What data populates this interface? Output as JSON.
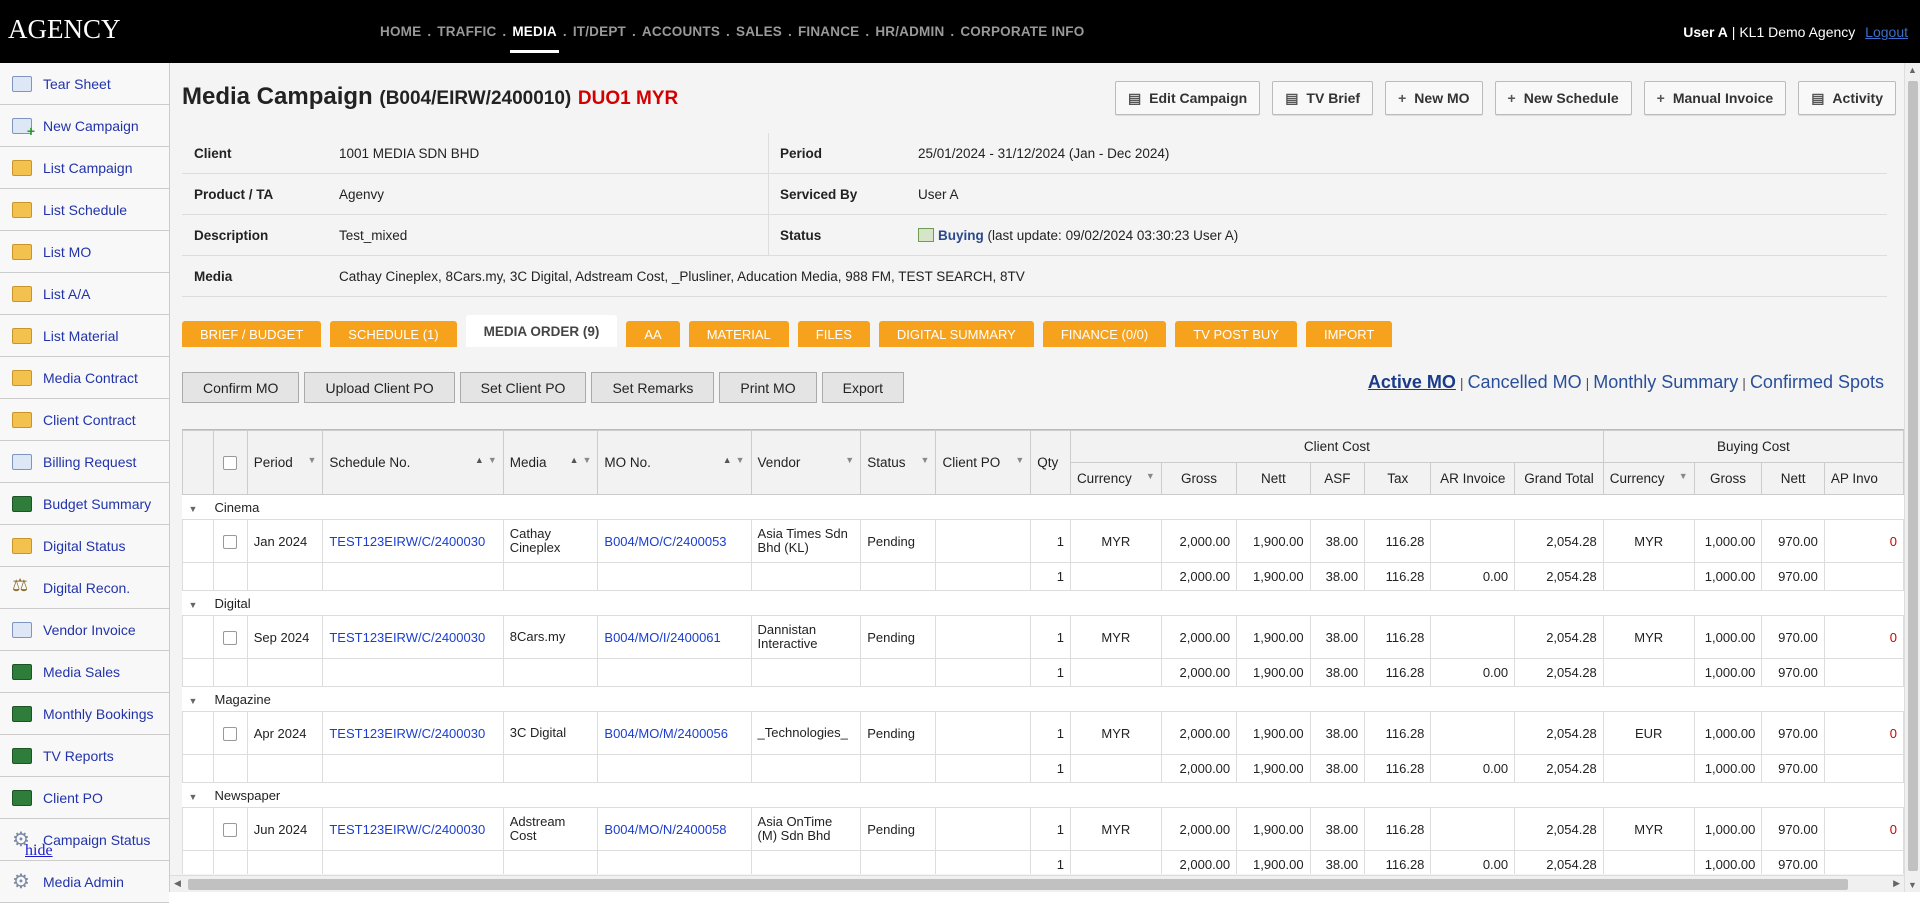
{
  "app": {
    "logo": "AGENCY"
  },
  "nav": {
    "items": [
      "HOME",
      "TRAFFIC",
      "MEDIA",
      "IT/DEPT",
      "ACCOUNTS",
      "SALES",
      "FINANCE",
      "HR/ADMIN",
      "CORPORATE INFO"
    ],
    "active": "MEDIA"
  },
  "user": {
    "name": "User A",
    "agency": "| KL1 Demo Agency",
    "logout": "Logout"
  },
  "sidebar": {
    "items": [
      {
        "label": "Tear Sheet",
        "icon": "page-icon"
      },
      {
        "label": "New Campaign",
        "icon": "new-page-icon"
      },
      {
        "label": "List Campaign",
        "icon": "folder-icon"
      },
      {
        "label": "List Schedule",
        "icon": "folder-icon"
      },
      {
        "label": "List MO",
        "icon": "folder-icon"
      },
      {
        "label": "List A/A",
        "icon": "folder-icon"
      },
      {
        "label": "List Material",
        "icon": "folder-icon"
      },
      {
        "label": "Media Contract",
        "icon": "folder-icon"
      },
      {
        "label": "Client Contract",
        "icon": "folder-icon"
      },
      {
        "label": "Billing Request",
        "icon": "page-icon"
      },
      {
        "label": "Budget Summary",
        "icon": "chart-icon"
      },
      {
        "label": "Digital Status",
        "icon": "folder-icon"
      },
      {
        "label": "Digital Recon.",
        "icon": "scale-icon"
      },
      {
        "label": "Vendor Invoice",
        "icon": "page-icon"
      },
      {
        "label": "Media Sales",
        "icon": "chart-icon"
      },
      {
        "label": "Monthly Bookings",
        "icon": "chart-icon"
      },
      {
        "label": "TV Reports",
        "icon": "chart-icon"
      },
      {
        "label": "Client PO",
        "icon": "chart-icon"
      },
      {
        "label": "Campaign Status",
        "icon": "gear-icon"
      },
      {
        "label": "Media Admin",
        "icon": "gear-icon"
      }
    ],
    "hide": "hide"
  },
  "page": {
    "title": "Media Campaign",
    "code": "(B004/EIRW/2400010)",
    "tag": "DUO1 MYR",
    "actions": [
      {
        "label": "Edit Campaign",
        "icon": "document-icon"
      },
      {
        "label": "TV Brief",
        "icon": "document-icon"
      },
      {
        "label": "New MO",
        "icon": "plus-icon"
      },
      {
        "label": "New Schedule",
        "icon": "plus-icon"
      },
      {
        "label": "Manual Invoice",
        "icon": "plus-icon"
      },
      {
        "label": "Activity",
        "icon": "document-icon"
      }
    ]
  },
  "info": {
    "client_label": "Client",
    "client": "1001 MEDIA SDN BHD",
    "period_label": "Period",
    "period": "25/01/2024 - 31/12/2024 (Jan - Dec 2024)",
    "product_label": "Product / TA",
    "product": "Agenvy",
    "serviced_label": "Serviced By",
    "serviced": "User A",
    "desc_label": "Description",
    "desc": "Test_mixed",
    "status_label": "Status",
    "status": "Buying",
    "status_note": "(last update: 09/02/2024 03:30:23 User A)",
    "media_label": "Media",
    "media": "Cathay Cineplex, 8Cars.my, 3C Digital, Adstream Cost, _Plusliner, Aducation Media, 988 FM, TEST SEARCH, 8TV"
  },
  "tabs": [
    "BRIEF / BUDGET",
    "SCHEDULE (1)",
    "MEDIA ORDER (9)",
    "AA",
    "MATERIAL",
    "FILES",
    "DIGITAL SUMMARY",
    "FINANCE (0/0)",
    "TV POST BUY",
    "IMPORT"
  ],
  "toolbar": [
    "Confirm MO",
    "Upload Client PO",
    "Set Client PO",
    "Set Remarks",
    "Print MO",
    "Export"
  ],
  "views": [
    "Active MO",
    "Cancelled MO",
    "Monthly Summary",
    "Confirmed Spots"
  ],
  "grid": {
    "group_headers": {
      "client_cost": "Client Cost",
      "buying_cost": "Buying Cost"
    },
    "columns": {
      "period": "Period",
      "schedule": "Schedule No.",
      "media": "Media",
      "mo": "MO No.",
      "vendor": "Vendor",
      "status": "Status",
      "client_po": "Client PO",
      "qty": "Qty",
      "currency": "Currency",
      "gross": "Gross",
      "nett": "Nett",
      "asf": "ASF",
      "tax": "Tax",
      "ar_invoice": "AR Invoice",
      "grand_total": "Grand Total",
      "b_currency": "Currency",
      "b_gross": "Gross",
      "b_nett": "Nett",
      "ap_invoice": "AP Invo"
    },
    "groups": [
      {
        "name": "Cinema",
        "row": {
          "period": "Jan 2024",
          "schedule": "TEST123EIRW/C/2400030",
          "media": "Cathay Cineplex",
          "mo": "B004/MO/C/2400053",
          "vendor": "Asia Times Sdn Bhd (KL)",
          "status": "Pending",
          "client_po": "",
          "qty": "1",
          "currency": "MYR",
          "gross": "2,000.00",
          "nett": "1,900.00",
          "asf": "38.00",
          "tax": "116.28",
          "ar_invoice": "",
          "grand_total": "2,054.28",
          "b_currency": "MYR",
          "b_gross": "1,000.00",
          "b_nett": "970.00",
          "ap": "0"
        },
        "sum": {
          "qty": "1",
          "gross": "2,000.00",
          "nett": "1,900.00",
          "asf": "38.00",
          "tax": "116.28",
          "ar_invoice": "0.00",
          "grand_total": "2,054.28",
          "b_gross": "1,000.00",
          "b_nett": "970.00"
        }
      },
      {
        "name": "Digital",
        "row": {
          "period": "Sep 2024",
          "schedule": "TEST123EIRW/C/2400030",
          "media": "8Cars.my",
          "mo": "B004/MO/I/2400061",
          "vendor": "Dannistan Interactive",
          "status": "Pending",
          "client_po": "",
          "qty": "1",
          "currency": "MYR",
          "gross": "2,000.00",
          "nett": "1,900.00",
          "asf": "38.00",
          "tax": "116.28",
          "ar_invoice": "",
          "grand_total": "2,054.28",
          "b_currency": "MYR",
          "b_gross": "1,000.00",
          "b_nett": "970.00",
          "ap": "0"
        },
        "sum": {
          "qty": "1",
          "gross": "2,000.00",
          "nett": "1,900.00",
          "asf": "38.00",
          "tax": "116.28",
          "ar_invoice": "0.00",
          "grand_total": "2,054.28",
          "b_gross": "1,000.00",
          "b_nett": "970.00"
        }
      },
      {
        "name": "Magazine",
        "row": {
          "period": "Apr 2024",
          "schedule": "TEST123EIRW/C/2400030",
          "media": "3C Digital",
          "mo": "B004/MO/M/2400056",
          "vendor": "_Technologies_",
          "status": "Pending",
          "client_po": "",
          "qty": "1",
          "currency": "MYR",
          "gross": "2,000.00",
          "nett": "1,900.00",
          "asf": "38.00",
          "tax": "116.28",
          "ar_invoice": "",
          "grand_total": "2,054.28",
          "b_currency": "EUR",
          "b_gross": "1,000.00",
          "b_nett": "970.00",
          "ap": "0"
        },
        "sum": {
          "qty": "1",
          "gross": "2,000.00",
          "nett": "1,900.00",
          "asf": "38.00",
          "tax": "116.28",
          "ar_invoice": "0.00",
          "grand_total": "2,054.28",
          "b_gross": "1,000.00",
          "b_nett": "970.00"
        }
      },
      {
        "name": "Newspaper",
        "row": {
          "period": "Jun 2024",
          "schedule": "TEST123EIRW/C/2400030",
          "media": "Adstream Cost",
          "mo": "B004/MO/N/2400058",
          "vendor": "Asia OnTime (M) Sdn Bhd",
          "status": "Pending",
          "client_po": "",
          "qty": "1",
          "currency": "MYR",
          "gross": "2,000.00",
          "nett": "1,900.00",
          "asf": "38.00",
          "tax": "116.28",
          "ar_invoice": "",
          "grand_total": "2,054.28",
          "b_currency": "MYR",
          "b_gross": "1,000.00",
          "b_nett": "970.00",
          "ap": "0"
        },
        "sum": {
          "qty": "1",
          "gross": "2,000.00",
          "nett": "1,900.00",
          "asf": "38.00",
          "tax": "116.28",
          "ar_invoice": "0.00",
          "grand_total": "2,054.28",
          "b_gross": "1,000.00",
          "b_nett": "970.00"
        }
      }
    ]
  }
}
